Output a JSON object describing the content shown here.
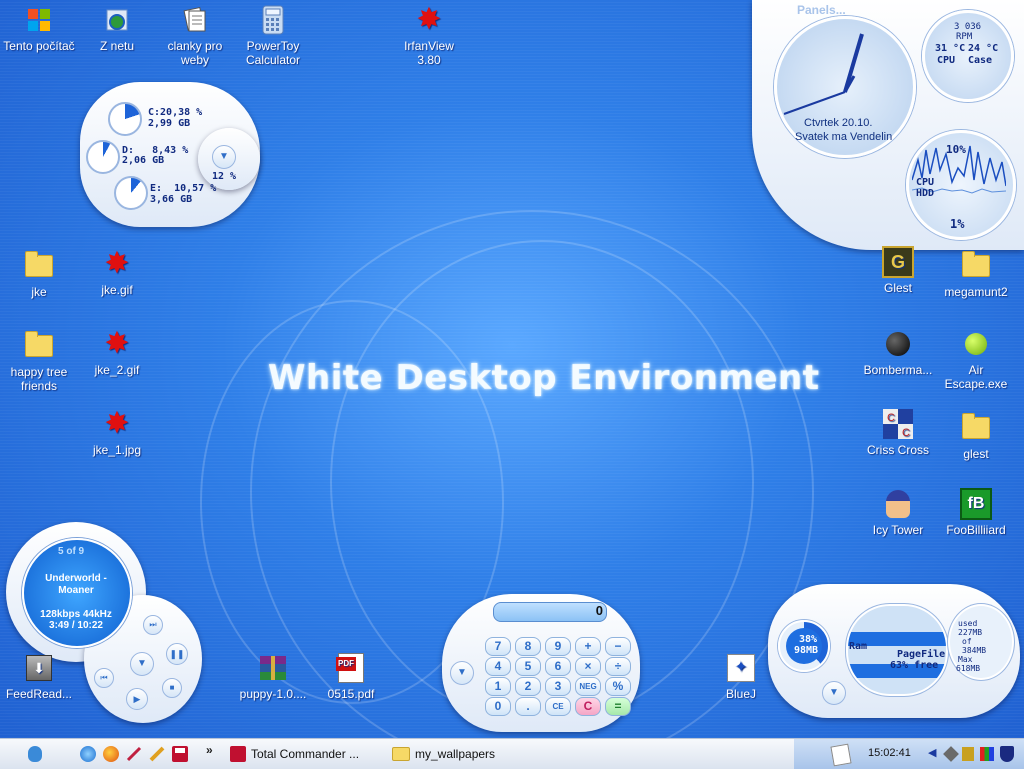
{
  "desktop": {
    "title": "White Desktop Environment",
    "icons_left": [
      {
        "label": "Tento počítač",
        "icon": "computer-icon"
      },
      {
        "label": "Z netu",
        "icon": "network-icon"
      },
      {
        "label": "clanky pro weby",
        "icon": "documents-icon"
      },
      {
        "label": "PowerToy Calculator",
        "icon": "calculator-icon"
      },
      {
        "label": "IrfanView 3.80",
        "icon": "irfanview-icon"
      },
      {
        "label": "jke",
        "icon": "folder-icon"
      },
      {
        "label": "jke.gif",
        "icon": "image-icon"
      },
      {
        "label": "happy tree friends",
        "icon": "folder-icon"
      },
      {
        "label": "jke_2.gif",
        "icon": "image-icon"
      },
      {
        "label": "jke_1.jpg",
        "icon": "image-icon"
      },
      {
        "label": "FeedRead...",
        "icon": "feedreader-icon"
      },
      {
        "label": "puppy-1.0....",
        "icon": "archive-icon"
      },
      {
        "label": "0515.pdf",
        "icon": "pdf-icon"
      },
      {
        "label": "BlueJ",
        "icon": "bluej-icon"
      }
    ],
    "icons_right": [
      {
        "label": "Glest",
        "icon": "glest-icon"
      },
      {
        "label": "megamunt2",
        "icon": "folder-icon"
      },
      {
        "label": "Bomberma...",
        "icon": "bomb-icon"
      },
      {
        "label": "Air Escape.exe",
        "icon": "ball-icon"
      },
      {
        "label": "Criss Cross",
        "icon": "crisscross-icon"
      },
      {
        "label": "glest",
        "icon": "folder-icon"
      },
      {
        "label": "Icy Tower",
        "icon": "icytower-icon"
      },
      {
        "label": "FooBilliiard",
        "icon": "foobilliard-icon"
      }
    ]
  },
  "disk_widget": {
    "c_label": "C:20,38 %",
    "c_size": "2,99 GB",
    "d_label": "D:   8,43 %",
    "d_size": "2,06 GB",
    "e_label": "E:  10,57 %",
    "e_size": "3,66 GB",
    "total": "12 %",
    "c_fraction": 0.2038,
    "d_fraction": 0.0843,
    "e_fraction": 0.1057
  },
  "panels": {
    "title": "Panels...",
    "clock_date": "Ctvrtek 20.10.",
    "clock_name": "Svatek ma Vendelin",
    "rpm": "3 036",
    "rpm_unit": "RPM",
    "cpu_temp": "31 °C",
    "case_temp": "24 °C",
    "cpu_label": "CPU",
    "case_label": "Case",
    "cpu_pct": "10%",
    "graph_label_1": "CPU",
    "graph_label_2": "HDD",
    "cpu_now": "1%"
  },
  "player": {
    "track_index": "5 of 9",
    "track": "Underworld - Moaner",
    "bitrate": "128kbps 44kHz",
    "time": "3:49 / 10:22"
  },
  "calculator": {
    "display": "0",
    "buttons": [
      "7",
      "8",
      "9",
      "+",
      "−",
      "4",
      "5",
      "6",
      "×",
      "÷",
      "1",
      "2",
      "3",
      "NEG",
      "%",
      "0",
      ".",
      "CE",
      "C",
      "="
    ]
  },
  "memory": {
    "ram_pct": "38%",
    "ram_mb": "98MB",
    "ram_label": "Ram",
    "pagefile_label": "PageFile",
    "pagefile_free": "63% free",
    "used_label": "used",
    "used_value": "227MB",
    "of_label": "of",
    "of_value": "384MB",
    "max_label": "Max",
    "max_value": "618MB"
  },
  "taskbar": {
    "quick_chevron": "»",
    "tasks": [
      {
        "label": "Total Commander ...",
        "icon": "floppy-icon"
      },
      {
        "label": "my_wallpapers",
        "icon": "folder-icon"
      }
    ],
    "clock": "15:02:41"
  }
}
